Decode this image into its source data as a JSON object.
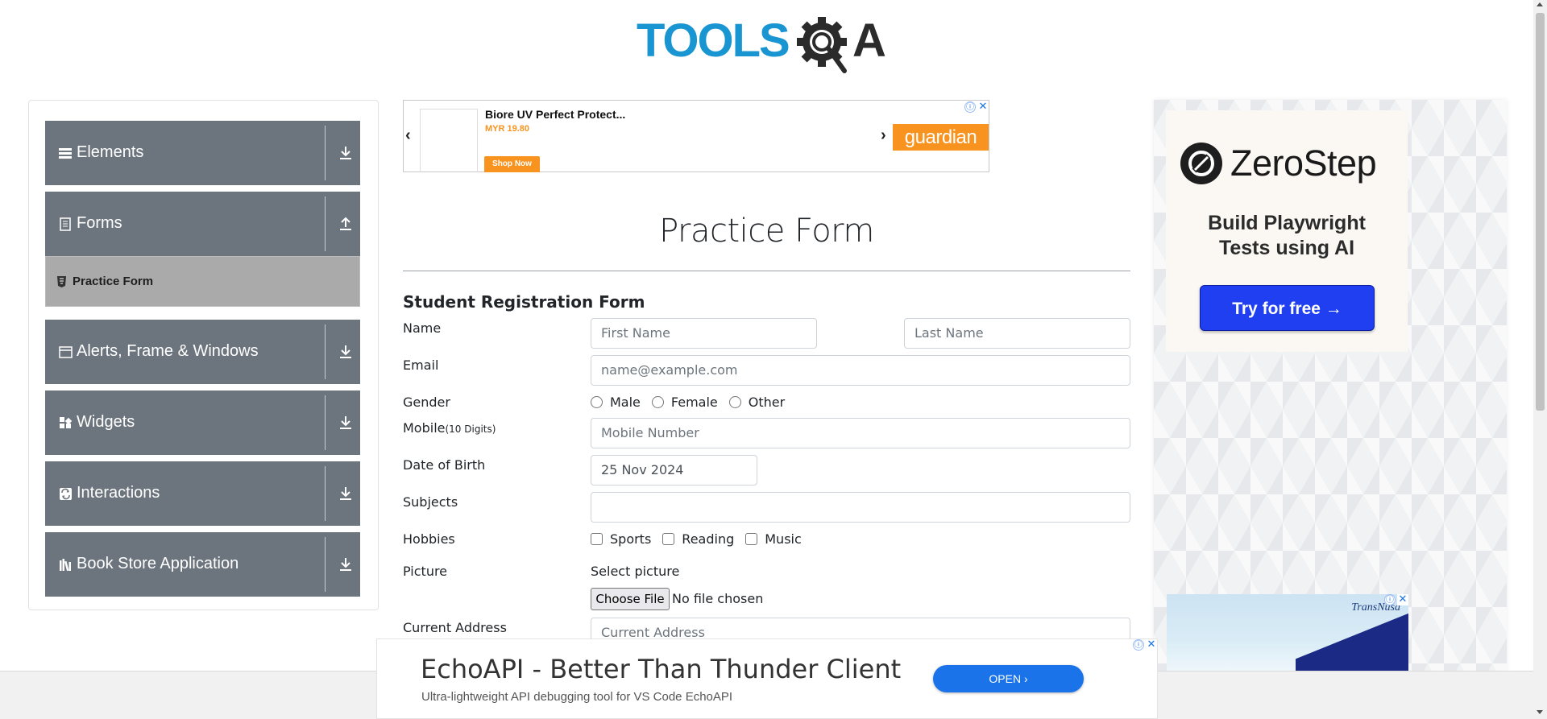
{
  "logo": {
    "text_left": "TOOLS",
    "text_right": "A"
  },
  "sidebar": {
    "groups": [
      {
        "label": "Elements",
        "icon": "hamburger-icon",
        "arrow": "download-icon"
      },
      {
        "label": "Forms",
        "icon": "document-icon",
        "arrow": "upload-icon",
        "items": [
          {
            "label": "Practice Form",
            "icon": "html5-icon"
          }
        ]
      },
      {
        "label": "Alerts, Frame & Windows",
        "icon": "window-icon",
        "arrow": "download-icon"
      },
      {
        "label": "Widgets",
        "icon": "widgets-icon",
        "arrow": "download-icon"
      },
      {
        "label": "Interactions",
        "icon": "interactions-icon",
        "arrow": "download-icon"
      },
      {
        "label": "Book Store Application",
        "icon": "books-icon",
        "arrow": "download-icon"
      }
    ]
  },
  "top_ad": {
    "title": "Biore UV Perfect Protect...",
    "price": "MYR 19.80",
    "cta": "Shop Now",
    "brand": "guardian",
    "prev": "‹",
    "next": "›"
  },
  "form": {
    "page_title": "Practice Form",
    "heading": "Student Registration Form",
    "name_label": "Name",
    "first_name_placeholder": "First Name",
    "last_name_placeholder": "Last Name",
    "email_label": "Email",
    "email_placeholder": "name@example.com",
    "gender_label": "Gender",
    "genders": [
      "Male",
      "Female",
      "Other"
    ],
    "mobile_label": "Mobile",
    "mobile_hint": "(10 Digits)",
    "mobile_placeholder": "Mobile Number",
    "dob_label": "Date of Birth",
    "dob_value": "25 Nov 2024",
    "subjects_label": "Subjects",
    "subjects_value": "",
    "hobbies_label": "Hobbies",
    "hobbies": [
      "Sports",
      "Reading",
      "Music"
    ],
    "picture_label": "Picture",
    "picture_caption": "Select picture",
    "file_button": "Choose File",
    "file_status": "No file chosen",
    "address_label": "Current Address",
    "address_placeholder": "Current Address"
  },
  "right_ad": {
    "brand": "ZeroStep",
    "tagline_1": "Build Playwright",
    "tagline_2": "Tests using AI",
    "cta": "Try for free →",
    "second_brand": "TransNusa"
  },
  "bottom_ad": {
    "title": "EchoAPI - Better Than Thunder Client",
    "subtitle": "Ultra-lightweight API debugging tool for VS Code EchoAPI",
    "cta": "OPEN"
  },
  "ad_controls": {
    "info": "ⓘ",
    "close": "✕"
  },
  "colors": {
    "sidebar_header": "#6c757d",
    "active_item": "#aaaaaa",
    "logo_blue": "#1995d1",
    "ad_orange": "#f7931e",
    "cta_blue": "#1f3ff0"
  }
}
